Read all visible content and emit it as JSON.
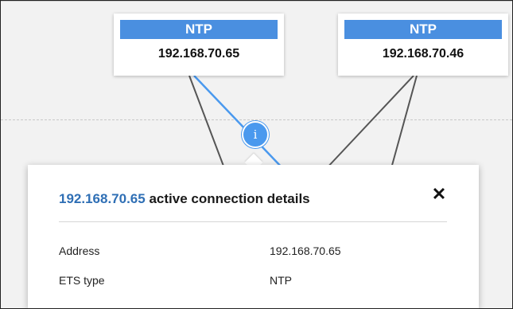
{
  "nodes": [
    {
      "type": "NTP",
      "ip": "192.168.70.65"
    },
    {
      "type": "NTP",
      "ip": "192.168.70.46"
    }
  ],
  "info_icon": {
    "glyph": "i",
    "icon": "info-icon"
  },
  "popover": {
    "title_highlight": "192.168.70.65",
    "title_text": " active connection details",
    "close_glyph": "✕",
    "rows": [
      {
        "label": "Address",
        "value": "192.168.70.65"
      },
      {
        "label": "ETS type",
        "value": "NTP"
      }
    ]
  },
  "colors": {
    "accent": "#4a8fe0",
    "active_link": "#4a99ee",
    "link": "#555555",
    "title_highlight": "#2f6fb5"
  }
}
